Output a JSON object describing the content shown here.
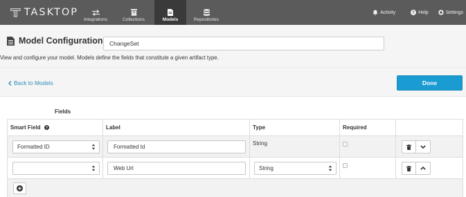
{
  "topbar": {
    "logo_text": "TASKTOP",
    "nav": [
      {
        "label": "Integrations",
        "icon": "arrows-exchange-icon"
      },
      {
        "label": "Collections",
        "icon": "trash-box-icon"
      },
      {
        "label": "Models",
        "icon": "document-icon",
        "active": true
      },
      {
        "label": "Repositories",
        "icon": "database-icon"
      }
    ],
    "right": {
      "activity": "Activity",
      "help": "Help",
      "settings": "Settings"
    },
    "colors": {
      "bar": "#5b5b5b",
      "active_tab": "#3a3a3a"
    }
  },
  "header": {
    "title": "Model Configuration",
    "model_name": "ChangeSet",
    "description": "View and configure your model. Models define the fields that constitute a given artifact type."
  },
  "actions": {
    "back_label": "Back to Models",
    "done_label": "Done",
    "colors": {
      "link": "#2a8db8",
      "done": "#1a9bd1"
    }
  },
  "fields": {
    "heading": "Fields",
    "columns": {
      "smart_field": "Smart Field",
      "label": "Label",
      "type": "Type",
      "required": "Required"
    },
    "rows": [
      {
        "smart_field": "Formatted ID",
        "label": "Formatted Id",
        "type": "String",
        "type_editable": false,
        "required": false,
        "expand": "collapsed"
      },
      {
        "smart_field": "",
        "label": "Web Url",
        "type": "String",
        "type_editable": true,
        "required": false,
        "expand": "expanded"
      }
    ]
  }
}
